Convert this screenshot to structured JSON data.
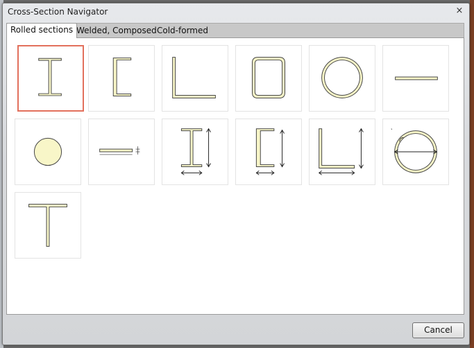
{
  "window": {
    "title": "Cross-Section Navigator",
    "close_glyph": "×"
  },
  "tabs": [
    {
      "label": "Rolled sections",
      "active": true
    },
    {
      "label": "Welded, Composed",
      "active": false
    },
    {
      "label": "Cold-formed",
      "active": false
    }
  ],
  "sections": [
    {
      "name": "i-section-icon",
      "selected": true
    },
    {
      "name": "channel-section-icon",
      "selected": false
    },
    {
      "name": "angle-section-icon",
      "selected": false
    },
    {
      "name": "rectangular-hollow-section-icon",
      "selected": false
    },
    {
      "name": "circular-hollow-section-icon",
      "selected": false
    },
    {
      "name": "flat-bar-icon",
      "selected": false
    },
    {
      "name": "round-bar-icon",
      "selected": false
    },
    {
      "name": "flat-bar-dimensioned-icon",
      "selected": false
    },
    {
      "name": "i-section-dimensioned-icon",
      "selected": false
    },
    {
      "name": "channel-section-dimensioned-icon",
      "selected": false
    },
    {
      "name": "angle-section-dimensioned-icon",
      "selected": false
    },
    {
      "name": "circular-hollow-dimensioned-icon",
      "selected": false
    },
    {
      "name": "t-section-icon",
      "selected": false
    }
  ],
  "buttons": {
    "cancel_label": "Cancel"
  },
  "colors": {
    "section_fill": "#f8f6c8",
    "selection_border": "#e2705c"
  }
}
